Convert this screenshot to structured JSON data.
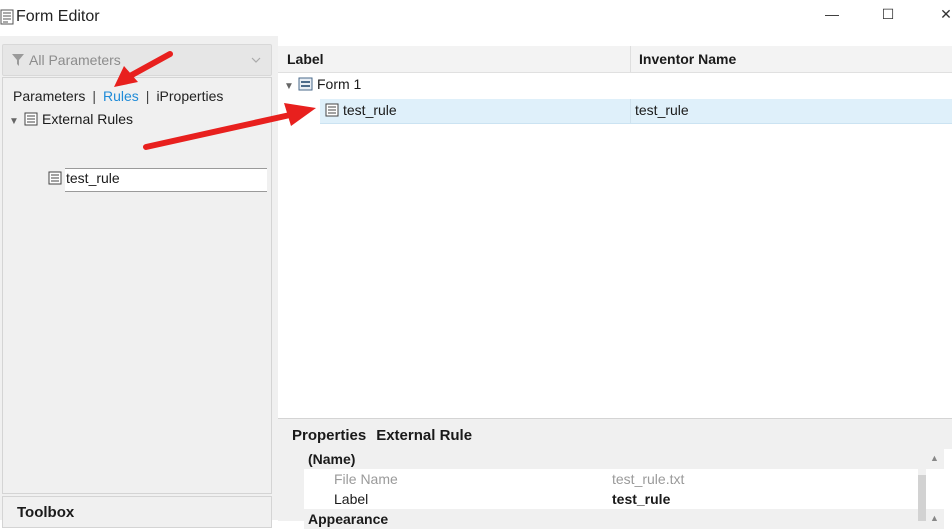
{
  "window": {
    "title": "Form Editor",
    "minimize_glyph": "—",
    "maximize_glyph": "☐",
    "close_glyph": "✕"
  },
  "left_pane": {
    "filter": {
      "label": "All Parameters",
      "icon": "filter-icon"
    },
    "tabs": [
      {
        "label": "Parameters",
        "active": false
      },
      {
        "label": "Rules",
        "active": true
      },
      {
        "label": "iProperties",
        "active": false
      }
    ],
    "tab_separator": "|",
    "tree": {
      "root": {
        "label": "External Rules",
        "icon": "rule-scroll-icon",
        "expanded": true
      },
      "children": [
        {
          "label": "test_rule",
          "icon": "rule-scroll-icon",
          "selected": true
        }
      ]
    },
    "toolbox_label": "Toolbox"
  },
  "form_tree": {
    "columns": [
      "Label",
      "Inventor Name"
    ],
    "root": {
      "label": "Form 1",
      "icon": "form-icon",
      "expanded": true
    },
    "rows": [
      {
        "label": "test_rule",
        "inventor_name": "test_rule",
        "icon": "rule-scroll-icon",
        "selected": true
      }
    ]
  },
  "properties": {
    "title": "Properties",
    "subtitle": "External Rule",
    "categories": [
      {
        "name": "(Name)",
        "items": [
          {
            "key": "File Name",
            "value": "test_rule.txt",
            "readonly": true
          },
          {
            "key": "Label",
            "value": "test_rule",
            "readonly": false
          }
        ]
      },
      {
        "name": "Appearance",
        "items": []
      }
    ]
  },
  "colors": {
    "active_tab": "#1f8bd8",
    "selection_row": "#dff0fa",
    "annotation_arrow": "#e8201e"
  }
}
